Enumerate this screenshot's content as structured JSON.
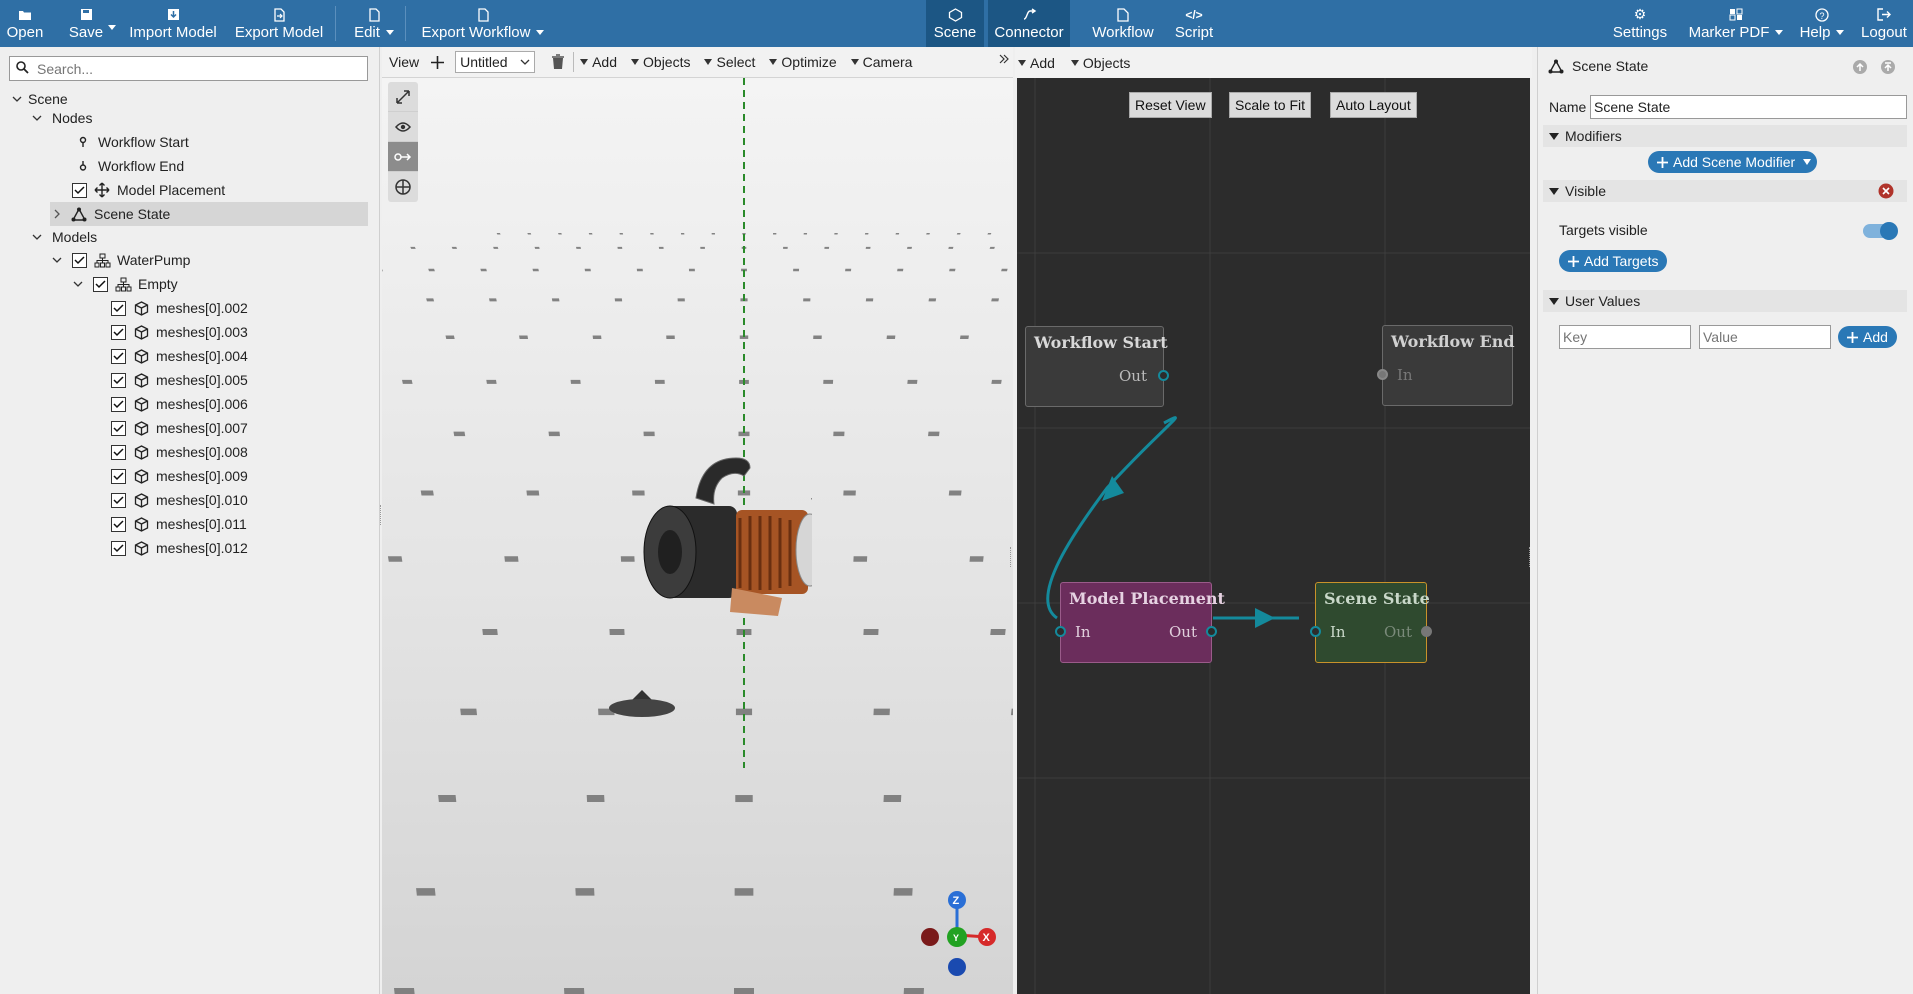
{
  "toolbar": {
    "open": "Open",
    "save": "Save",
    "import_model": "Import Model",
    "export_model": "Export Model",
    "edit": "Edit",
    "export_workflow": "Export Workflow",
    "scene": "Scene",
    "connector": "Connector",
    "workflow": "Workflow",
    "script": "Script",
    "settings": "Settings",
    "marker_pdf": "Marker PDF",
    "help": "Help",
    "logout": "Logout",
    "active_tab": "Connector",
    "brand_color": "#2f6fa5"
  },
  "left": {
    "search_placeholder": "Search...",
    "tree": {
      "scene": "Scene",
      "nodes": "Nodes",
      "workflow_start": "Workflow Start",
      "workflow_end": "Workflow End",
      "model_placement": "Model Placement",
      "scene_state": "Scene State",
      "models": "Models",
      "waterpump": "WaterPump",
      "empty": "Empty",
      "meshes": [
        "meshes[0].002",
        "meshes[0].003",
        "meshes[0].004",
        "meshes[0].005",
        "meshes[0].006",
        "meshes[0].007",
        "meshes[0].008",
        "meshes[0].009",
        "meshes[0].010",
        "meshes[0].011",
        "meshes[0].012"
      ]
    }
  },
  "viewport": {
    "view": "View",
    "scene_select": "Untitled",
    "add": "Add",
    "objects": "Objects",
    "select": "Select",
    "optimize": "Optimize",
    "camera": "Camera",
    "axis_z": "Z",
    "axis_x": "X",
    "axis_y": "Y"
  },
  "graph": {
    "add": "Add",
    "objects": "Objects",
    "reset_view": "Reset View",
    "scale_to_fit": "Scale to Fit",
    "auto_layout": "Auto Layout",
    "node_workflow_start": {
      "title": "Workflow Start",
      "out": "Out"
    },
    "node_workflow_end": {
      "title": "Workflow End",
      "in": "In"
    },
    "node_model_placement": {
      "title": "Model Placement",
      "in": "In",
      "out": "Out",
      "color": "#6b2d5c"
    },
    "node_scene_state": {
      "title": "Scene State",
      "in": "In",
      "out": "Out",
      "color": "#2f4a2f"
    },
    "connector_color": "#148a9c"
  },
  "props": {
    "header": "Scene State",
    "name_label": "Name",
    "name_value": "Scene State",
    "modifiers": "Modifiers",
    "add_scene_modifier": "Add Scene Modifier",
    "visible": "Visible",
    "targets_visible": "Targets visible",
    "targets_visible_on": true,
    "add_targets": "Add Targets",
    "user_values": "User Values",
    "key_placeholder": "Key",
    "value_placeholder": "Value",
    "add": "Add"
  }
}
